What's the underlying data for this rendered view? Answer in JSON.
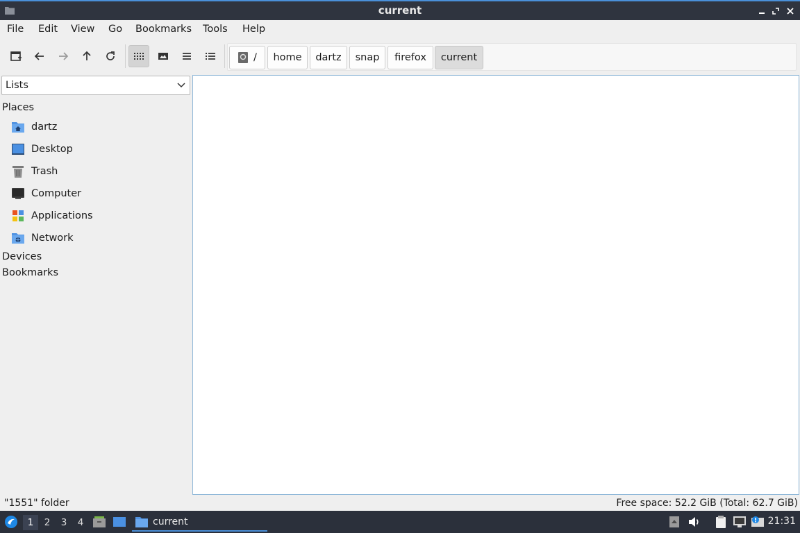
{
  "window": {
    "title": "current"
  },
  "menu": [
    "File",
    "Edit",
    "View",
    "Go",
    "Bookmarks",
    "Tools",
    "Help"
  ],
  "toolbar": {
    "buttons": [
      "new-tab",
      "back",
      "forward",
      "up",
      "reload",
      "icon-view",
      "thumbnail-view",
      "compact-view",
      "detailed-list-view"
    ],
    "active_view": "icon-view"
  },
  "path": {
    "root": "/",
    "crumbs": [
      "home",
      "dartz",
      "snap",
      "firefox",
      "current"
    ],
    "active": "current"
  },
  "sidebar": {
    "mode": "Lists",
    "places_header": "Places",
    "places": [
      {
        "label": "dartz",
        "icon": "home-folder-icon"
      },
      {
        "label": "Desktop",
        "icon": "desktop-icon"
      },
      {
        "label": "Trash",
        "icon": "trash-icon"
      },
      {
        "label": "Computer",
        "icon": "computer-icon"
      },
      {
        "label": "Applications",
        "icon": "applications-icon"
      },
      {
        "label": "Network",
        "icon": "network-folder-icon"
      }
    ],
    "devices_header": "Devices",
    "bookmarks_header": "Bookmarks"
  },
  "status": {
    "left": "\"1551\" folder",
    "right": "Free space: 52.2 GiB (Total: 62.7 GiB)"
  },
  "taskbar": {
    "workspaces": [
      "1",
      "2",
      "3",
      "4"
    ],
    "active_workspace": "1",
    "task_label": "current",
    "clock": "21:31"
  },
  "colors": {
    "accent": "#4a90d9",
    "titlebar": "#2f343f",
    "taskbar": "#2b303b",
    "folder": "#5294e2"
  }
}
